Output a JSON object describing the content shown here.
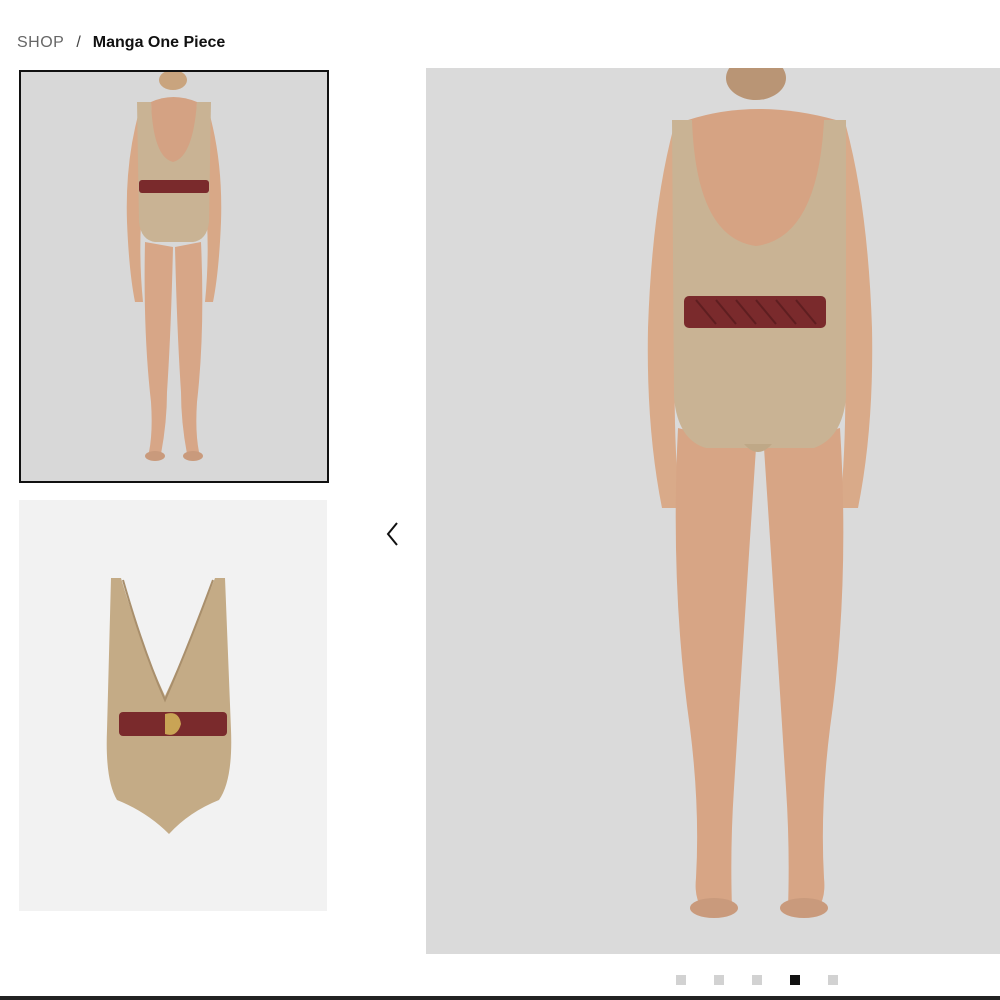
{
  "breadcrumb": {
    "shop": "SHOP",
    "separator": "/",
    "current": "Manga One Piece"
  },
  "gallery": {
    "thumbnails": [
      {
        "name": "thumbnail-back-view",
        "selected": true
      },
      {
        "name": "thumbnail-front-flat",
        "selected": false
      }
    ],
    "prev_icon": "chevron-left-icon",
    "dots": [
      {
        "active": false
      },
      {
        "active": false
      },
      {
        "active": false
      },
      {
        "active": true
      },
      {
        "active": false
      }
    ]
  },
  "colors": {
    "swimsuit": "#c9b394",
    "belt": "#7a2a2c",
    "skin": "#d9a98a",
    "background": "#dadada"
  }
}
